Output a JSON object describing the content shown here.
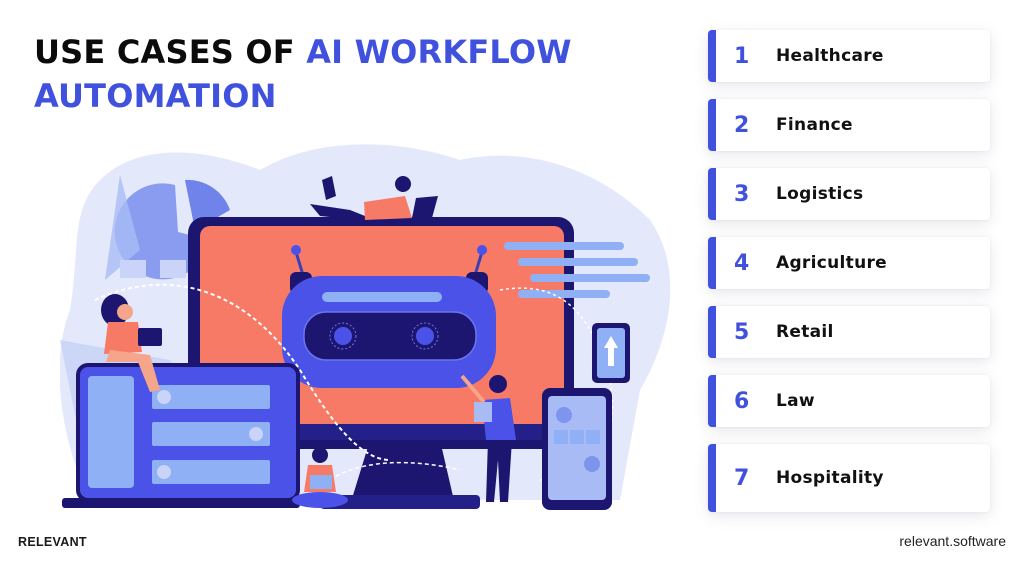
{
  "title": {
    "part1": "USE CASES OF ",
    "part2": "AI WORKFLOW",
    "part3": "AUTOMATION"
  },
  "colors": {
    "accent": "#3f51dd",
    "screen": "#f77a67",
    "navy": "#1c1670",
    "robot": "#4a52e8",
    "light_blue": "#8fb0f5",
    "bg_blob": "#e3e8fb"
  },
  "use_cases": [
    {
      "number": "1",
      "label": "Healthcare"
    },
    {
      "number": "2",
      "label": "Finance"
    },
    {
      "number": "3",
      "label": "Logistics"
    },
    {
      "number": "4",
      "label": "Agriculture"
    },
    {
      "number": "5",
      "label": "Retail"
    },
    {
      "number": "6",
      "label": "Law"
    },
    {
      "number": "7",
      "label": "Hospitality"
    }
  ],
  "illustration": {
    "description": "AI robot on a desktop monitor with people using laptops, tablet, phone and chat bubbles"
  },
  "footer": {
    "brand": "RELEVANT",
    "website": "relevant.software"
  }
}
